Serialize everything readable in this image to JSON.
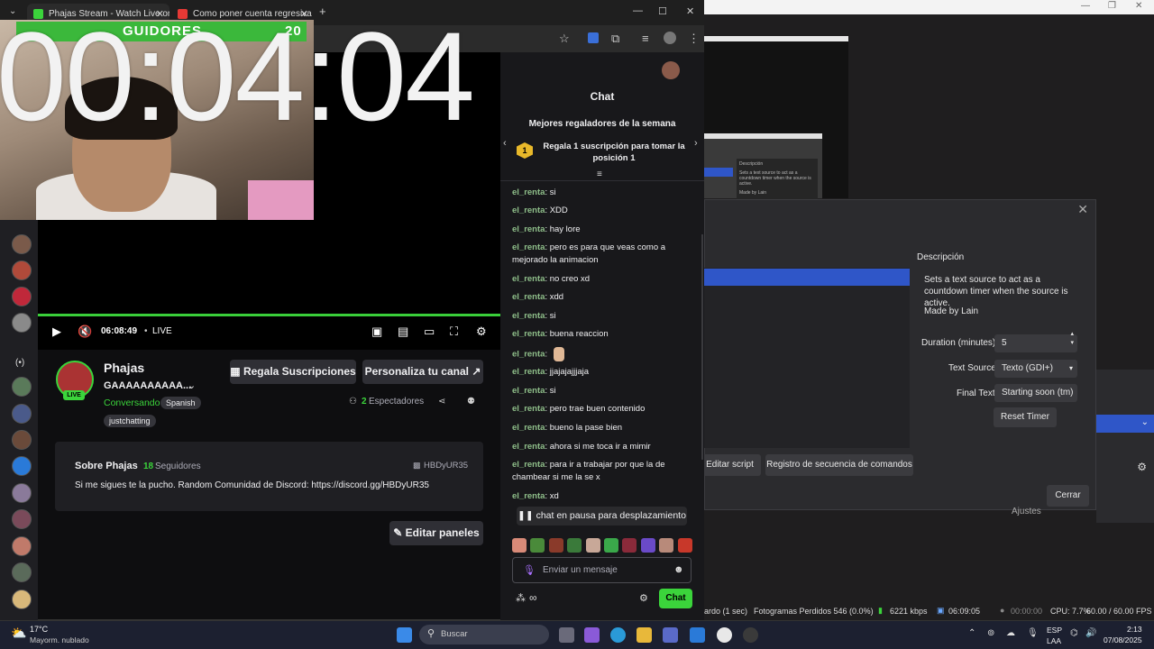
{
  "browser": {
    "tabs": [
      {
        "label": "Phajas Stream - Watch Live on ",
        "favicon_color": "#3bd43b"
      },
      {
        "label": "Como poner cuenta regresiva e",
        "favicon_color": "#e53935"
      }
    ],
    "new_tab": "+",
    "window_controls": {
      "minimize": "—",
      "maximize": "☐",
      "close": "✕"
    }
  },
  "overlay": {
    "timer": "00:04:04",
    "follower_banner": "GUIDORES",
    "follower_count": "20"
  },
  "player": {
    "time": "06:08:49",
    "live_label": "LIVE"
  },
  "channel": {
    "name": "Phajas",
    "title": "GAAAAAAAAAA...",
    "live_badge": "LIVE",
    "category": "Conversando",
    "language_tag": "Spanish",
    "tag": "justchatting",
    "gift_button": "Regala Suscripciones",
    "customize_button": "Personaliza tu canal",
    "viewers_count": "2",
    "viewers_label": "Espectadores",
    "about_title": "Sobre Phajas",
    "followers_count": "18",
    "followers_label": "Seguidores",
    "discord_handle": "HBDyUR35",
    "about_text": "Si me sigues te la pucho. Random Comunidad de Discord: https://discord.gg/HBDyUR35",
    "edit_panels": "Editar paneles"
  },
  "chat": {
    "header": "Chat",
    "top_gifters_title": "Mejores regaladores de la semana",
    "top_gifters_text": "Regala 1 suscripción para tomar la posición 1",
    "messages": [
      {
        "user": "el_renta",
        "text": "si"
      },
      {
        "user": "el_renta",
        "text": "XDD"
      },
      {
        "user": "el_renta",
        "text": "hay lore"
      },
      {
        "user": "el_renta",
        "text": "pero es para que veas como a mejorado la animacion"
      },
      {
        "user": "el_renta",
        "text": "no creo xd"
      },
      {
        "user": "el_renta",
        "text": "xdd"
      },
      {
        "user": "el_renta",
        "text": "si"
      },
      {
        "user": "el_renta",
        "text": "buena reaccion"
      },
      {
        "user": "el_renta",
        "text": ""
      },
      {
        "user": "el_renta",
        "text": "jjajajajjjaja"
      },
      {
        "user": "el_renta",
        "text": "si"
      },
      {
        "user": "el_renta",
        "text": "pero trae buen contenido"
      },
      {
        "user": "el_renta",
        "text": "bueno la pase bien"
      },
      {
        "user": "el_renta",
        "text": "ahora si me toca ir a mimir"
      },
      {
        "user": "el_renta",
        "text": "para ir a trabajar por que la de chambear si me la se x"
      },
      {
        "user": "el_renta",
        "text": "xd"
      }
    ],
    "paused_text": "chat en pausa para desplazamiento",
    "input_placeholder": "Enviar un mensaje",
    "send_button": "Chat"
  },
  "obs": {
    "description_title": "Descripción",
    "description_text": "Sets a text source to act as a countdown timer when the source is active.",
    "author": "Made by Lain",
    "duration_label": "Duration (minutes)",
    "duration_value": "5",
    "text_source_label": "Text Source",
    "text_source_value": "Texto (GDI+)",
    "final_text_label": "Final Text",
    "final_text_value": "Starting soon (tm)",
    "reset_timer": "Reset Timer",
    "edit_script": "Editar script",
    "script_log": "Registro de secuencia de comandos",
    "close": "Cerrar",
    "thumb_title": "Descripción",
    "thumb_text": "Sets a text source to act as a countdown timer when the source is active.",
    "thumb_author": "Made by Lain",
    "settings_tail": "Ajustes",
    "status": {
      "recording": "ardo (1 sec)",
      "dropped_frames": "Fotogramas Perdidos 546 (0.0%)",
      "bitrate": "6221 kbps",
      "stream_time": "06:09:05",
      "rec_time": "00:00:00",
      "cpu": "CPU: 7.7%",
      "fps": "60.00 / 60.00 FPS"
    }
  },
  "taskbar": {
    "weather_temp": "17°C",
    "weather_desc": "Mayorm. nublado",
    "search_placeholder": "Buscar",
    "lang": "ESP",
    "lang_sub": "LAA",
    "time": "2:13",
    "date": "07/08/2025"
  }
}
